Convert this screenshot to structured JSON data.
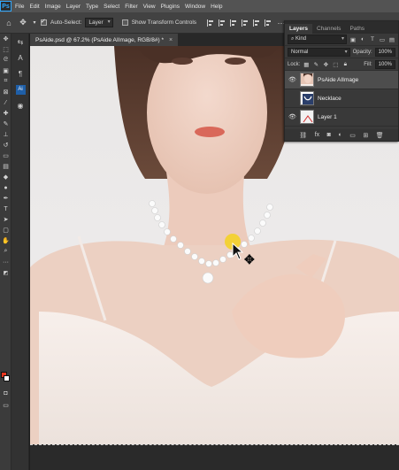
{
  "menubar": {
    "logo": "Ps",
    "items": [
      "File",
      "Edit",
      "Image",
      "Layer",
      "Type",
      "Select",
      "Filter",
      "View",
      "Plugins",
      "Window",
      "Help"
    ]
  },
  "options": {
    "auto_select_label": "Auto-Select:",
    "auto_select_value": "Layer",
    "transform_label": "Show Transform Controls"
  },
  "document": {
    "tab_title": "PsAide.psd @ 67.2% (PsAide AIImage, RGB/8#) *",
    "close": "×"
  },
  "layers_panel": {
    "tabs": [
      "Layers",
      "Channels",
      "Paths"
    ],
    "kind_label": "Kind",
    "blend_mode": "Normal",
    "opacity_label": "Opacity:",
    "opacity_value": "100%",
    "lock_label": "Lock:",
    "fill_label": "Fill:",
    "fill_value": "100%",
    "layers": [
      {
        "name": "PsAide AIImage",
        "visible": true,
        "selected": true
      },
      {
        "name": "Necklace",
        "visible": false,
        "selected": false
      },
      {
        "name": "Layer 1",
        "visible": true,
        "selected": false
      }
    ]
  },
  "colors": {
    "foreground": "#e8371f",
    "background": "#ffffff",
    "selection": "#4d4d4d"
  }
}
